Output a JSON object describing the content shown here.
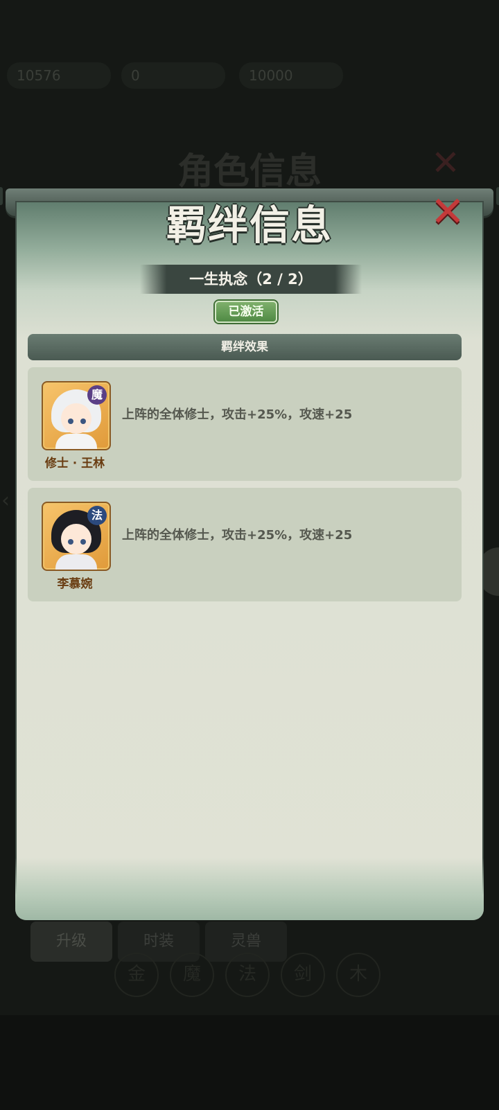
{
  "background": {
    "stats": [
      "10576",
      "0",
      "10000"
    ],
    "ghost_title": "角色信息",
    "tabs": [
      "升级",
      "时装",
      "灵兽"
    ],
    "circles": [
      "金",
      "魔",
      "法",
      "剑",
      "木"
    ]
  },
  "dialog": {
    "title": "羁绊信息",
    "bond_name": "一生执念（2 / 2）",
    "status_badge": "已激活",
    "section_header": "羁绊效果",
    "members": [
      {
        "name": "修士 · 王林",
        "tag": "魔",
        "effect": "上阵的全体修士，攻击+25%，攻速+25",
        "colors": {
          "hair": "#eef0f2",
          "outfit": "#f4f4f4",
          "tag_bg": "#5b3f86"
        }
      },
      {
        "name": "李慕婉",
        "tag": "法",
        "effect": "上阵的全体修士，攻击+25%，攻速+25",
        "colors": {
          "hair": "#1e1e24",
          "outfit": "#ececf0",
          "tag_bg": "#2c4a7e"
        }
      }
    ]
  },
  "colors": {
    "close_red": "#c43a3a",
    "badge_green": "#4f8a44",
    "panel_bg": "#e0e2d5",
    "card_bg": "#c9d0bf"
  }
}
